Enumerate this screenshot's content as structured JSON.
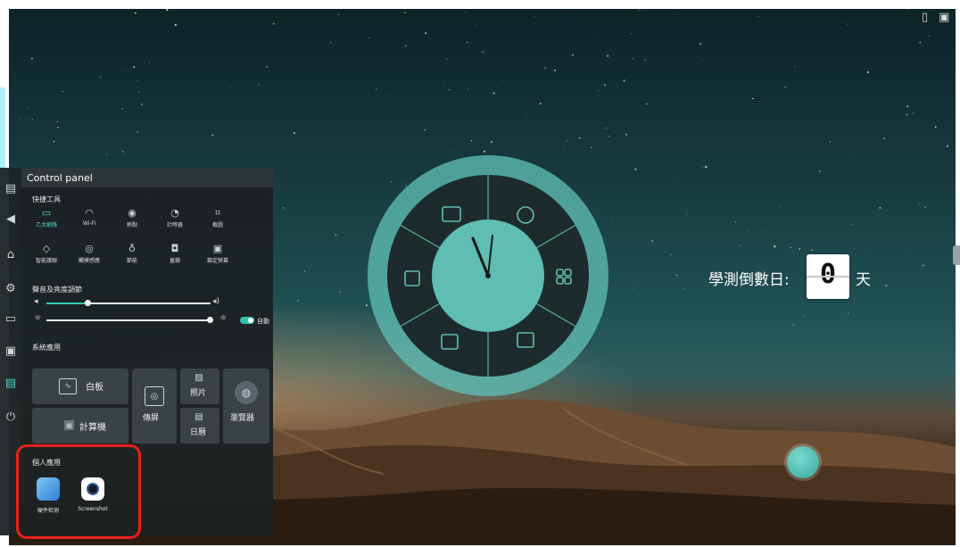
{
  "control_panel": {
    "title": "Control panel",
    "quick_tools": {
      "heading": "快捷工具",
      "items": [
        {
          "label": "乙太網路",
          "icon": "ethernet-icon",
          "active": true
        },
        {
          "label": "Wi-Fi",
          "icon": "wifi-icon"
        },
        {
          "label": "熱點",
          "icon": "hotspot-icon"
        },
        {
          "label": "計時器",
          "icon": "timer-icon"
        },
        {
          "label": "截圖",
          "icon": "crop-icon"
        },
        {
          "label": "智能護眼",
          "icon": "eye-care-icon"
        },
        {
          "label": "觸摸感應",
          "icon": "touch-sense-icon"
        },
        {
          "label": "節能",
          "icon": "energy-icon"
        },
        {
          "label": "童鎖",
          "icon": "child-lock-icon"
        },
        {
          "label": "鎖定熒幕",
          "icon": "lock-screen-icon"
        }
      ]
    },
    "sound_brightness": {
      "heading": "聲音及亮度調節",
      "volume_level": 0.25,
      "brightness_level": 1.0,
      "auto_label": "自動",
      "auto_on": true
    },
    "system_apps": {
      "heading": "系統應用",
      "whiteboard": "白板",
      "screen_share": "傳屏",
      "photos": "照片",
      "browser": "瀏覽器",
      "calculator": "計算機",
      "calendar": "日曆"
    },
    "personal_apps": {
      "heading": "個人應用",
      "items": [
        {
          "label": "硬件检测",
          "icon": "hardware-check-icon"
        },
        {
          "label": "Screenshot",
          "icon": "screenshot-icon"
        }
      ]
    }
  },
  "countdown": {
    "label": "學測倒數日:",
    "value": "0",
    "unit": "天"
  },
  "colors": {
    "accent": "#38c9b4",
    "highlight": "#e8201e",
    "wheel": "#5fbdb3"
  }
}
